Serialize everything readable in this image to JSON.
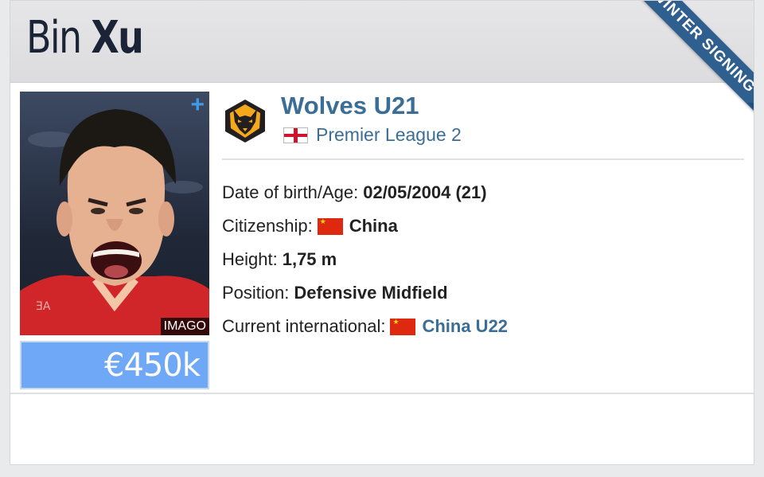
{
  "player": {
    "first_name": "Bin",
    "last_name": "Xu"
  },
  "ribbon": {
    "label": "WINTER SIGNING"
  },
  "photo": {
    "credit": "IMAGO",
    "add_icon": "+"
  },
  "market_value": "€450k",
  "club": {
    "name": "Wolves U21",
    "league": "Premier League 2"
  },
  "details": {
    "dob_label": "Date of birth/Age:",
    "dob_value": "02/05/2004 (21)",
    "citizenship_label": "Citizenship:",
    "citizenship_value": "China",
    "height_label": "Height:",
    "height_value": "1,75 m",
    "position_label": "Position:",
    "position_value": "Defensive Midfield",
    "international_label": "Current international:",
    "international_value": "China U22"
  },
  "colors": {
    "accent": "#3b6e97",
    "market_value_bg": "#6fa8f7",
    "ribbon": "#2f5f8f",
    "wolves_gold": "#f4a81c"
  },
  "icons": {
    "club_logo": "wolves-crest-icon",
    "league_flag": "england-flag-icon",
    "citizenship_flag": "china-flag-icon",
    "international_flag": "china-flag-icon"
  }
}
